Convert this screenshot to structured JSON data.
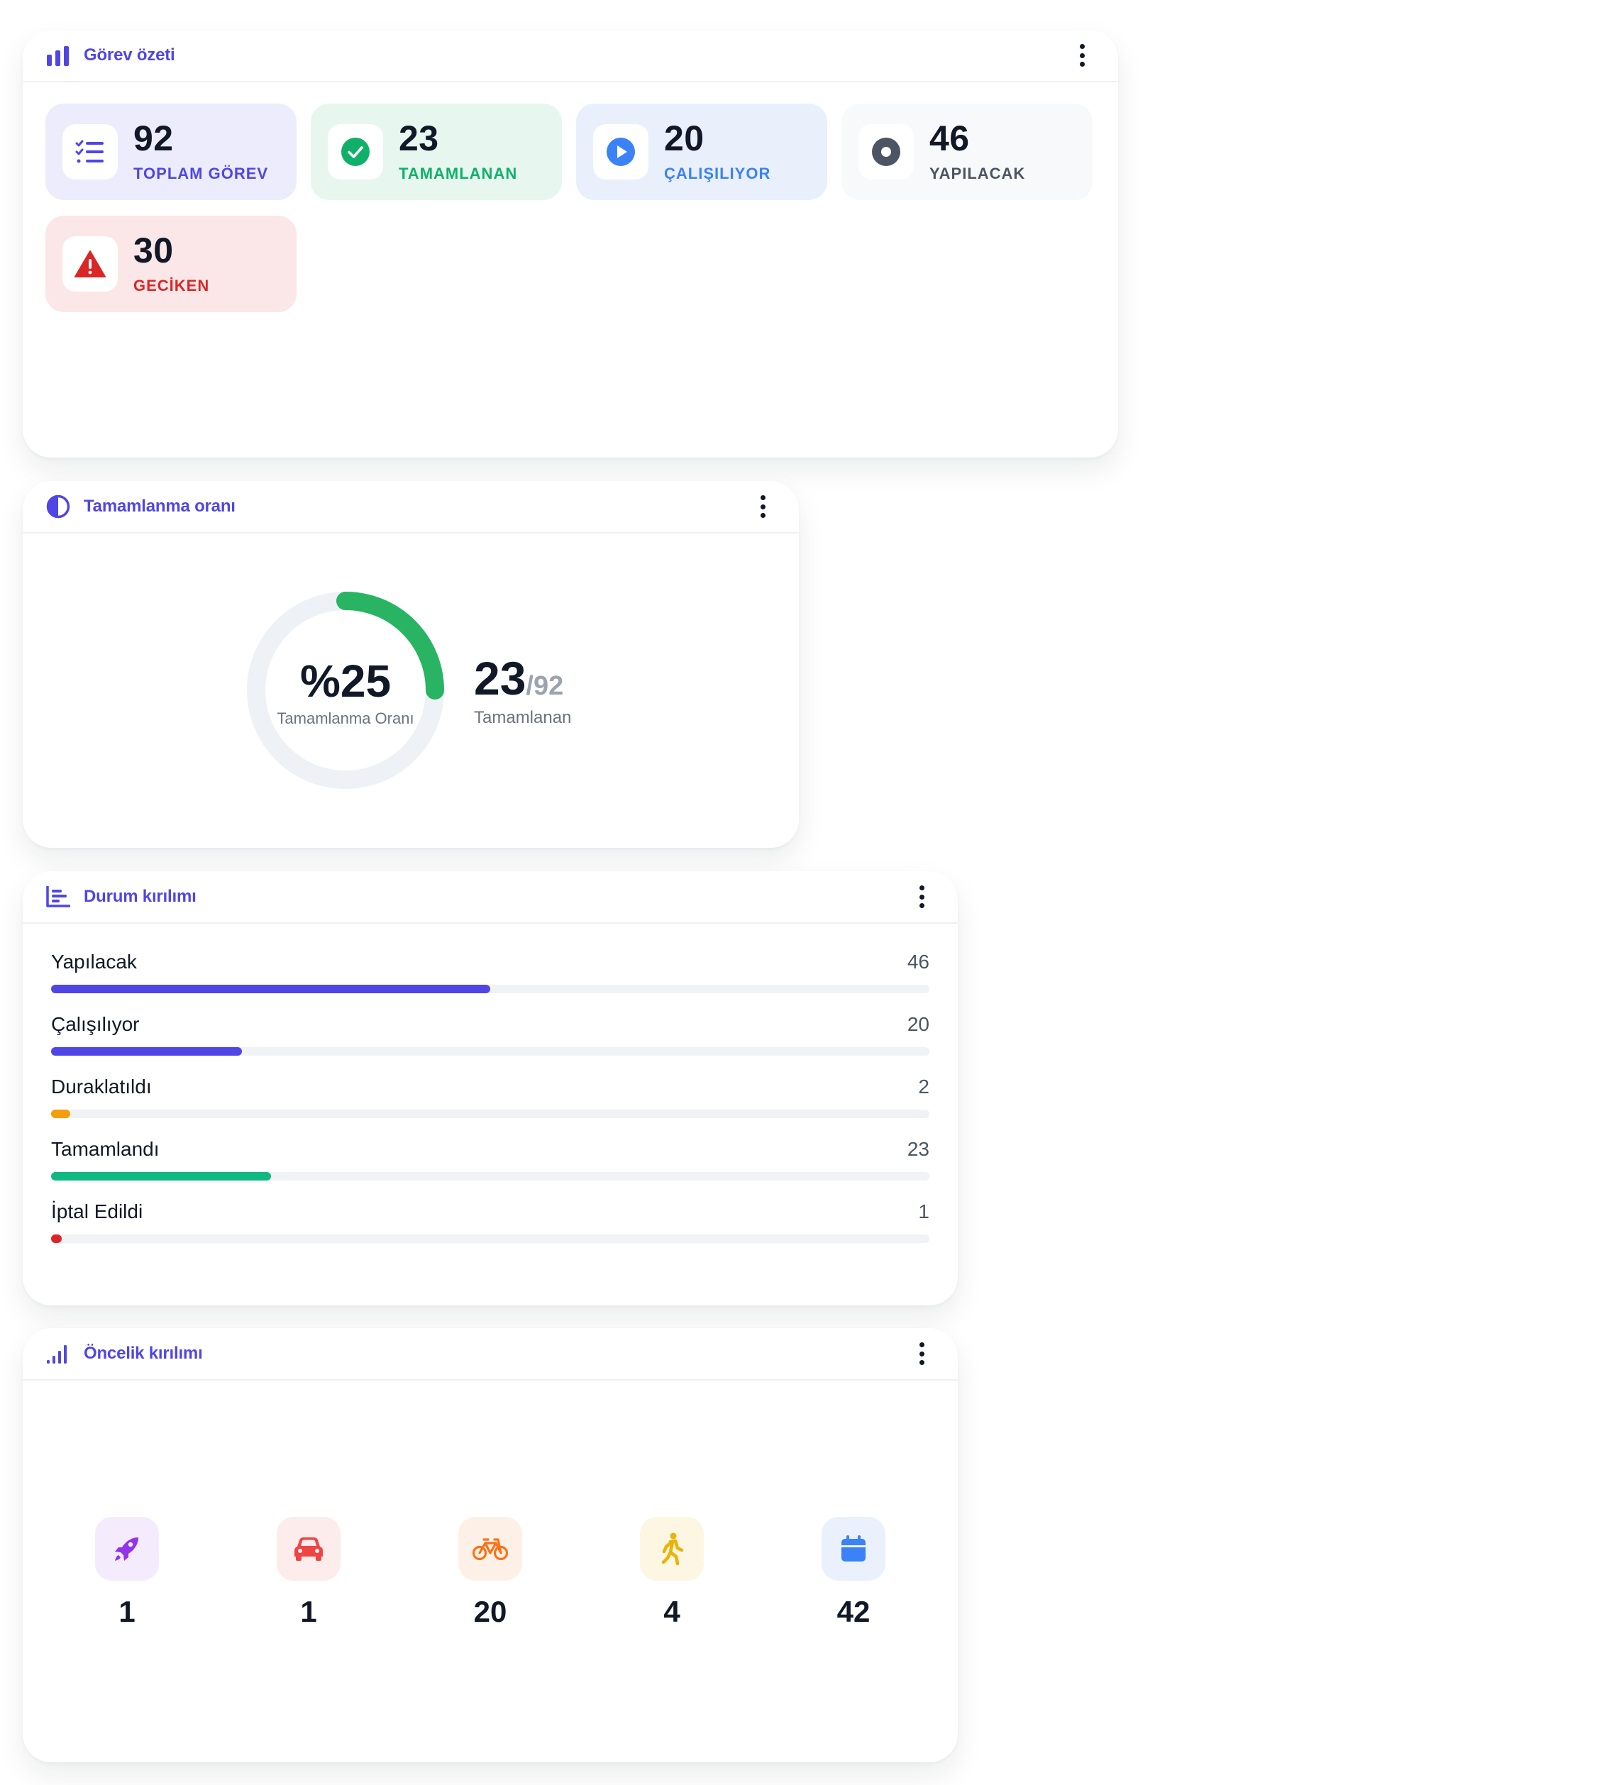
{
  "summary": {
    "title": "Görev özeti",
    "tiles": [
      {
        "value": "92",
        "label": "TOPLAM GÖREV",
        "icon": "task-list-icon",
        "bg": "#ececfc",
        "accent": "#4f46e5"
      },
      {
        "value": "23",
        "label": "TAMAMLANAN",
        "icon": "check-circle-icon",
        "bg": "#e7f7ef",
        "accent": "#10b06a"
      },
      {
        "value": "20",
        "label": "ÇALIŞILIYOR",
        "icon": "play-circle-icon",
        "bg": "#e9f0fc",
        "accent": "#3b82f6"
      },
      {
        "value": "46",
        "label": "YAPILACAK",
        "icon": "record-circle-icon",
        "bg": "#f8f9fb",
        "accent": "#4b5563"
      },
      {
        "value": "30",
        "label": "GECİKEN",
        "icon": "warning-triangle-icon",
        "bg": "#fbe7e7",
        "accent": "#dc2626"
      }
    ]
  },
  "completion": {
    "title": "Tamamlanma oranı",
    "percent_label": "%25",
    "percent": 25,
    "subtitle": "Tamamlanma Oranı",
    "completed": "23",
    "total": "/92",
    "caption": "Tamamlanan"
  },
  "status": {
    "title": "Durum kırılımı",
    "max": 92,
    "rows": [
      {
        "name": "Yapılacak",
        "value": 46,
        "color": "#4f46e5"
      },
      {
        "name": "Çalışılıyor",
        "value": 20,
        "color": "#4f46e5"
      },
      {
        "name": "Duraklatıldı",
        "value": 2,
        "color": "#f59e0b"
      },
      {
        "name": "Tamamlandı",
        "value": 23,
        "color": "#10b981"
      },
      {
        "name": "İptal Edildi",
        "value": 1,
        "color": "#dc2626"
      }
    ]
  },
  "priority": {
    "title": "Öncelik kırılımı",
    "items": [
      {
        "icon": "rocket-icon",
        "value": "1",
        "bg": "#f4ecfc",
        "color": "#9333ea"
      },
      {
        "icon": "car-icon",
        "value": "1",
        "bg": "#fdecec",
        "color": "#ef4444"
      },
      {
        "icon": "bicycle-icon",
        "value": "20",
        "bg": "#fdf1e7",
        "color": "#f97316"
      },
      {
        "icon": "walking-person-icon",
        "value": "4",
        "bg": "#fdf6e3",
        "color": "#eab308"
      },
      {
        "icon": "calendar-icon",
        "value": "42",
        "bg": "#eaf1fd",
        "color": "#3b82f6"
      }
    ]
  }
}
